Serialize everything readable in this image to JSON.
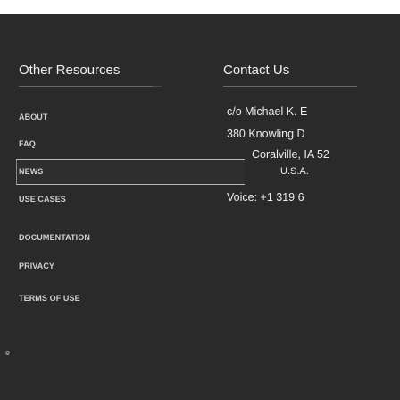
{
  "left": {
    "title": "Other Resources",
    "links": [
      "ABOUT",
      "FAQ",
      "NEWS",
      "USE CASES",
      "DOCUMENTATION",
      "PRIVACY",
      "TERMS OF USE"
    ]
  },
  "right": {
    "title": "Contact Us",
    "address": [
      "c/o Michael K. E",
      "380 Knowling D",
      "Coralville, IA 52",
      "U.S.A."
    ],
    "voice": "Voice: +1 319 6"
  },
  "edge": "e"
}
